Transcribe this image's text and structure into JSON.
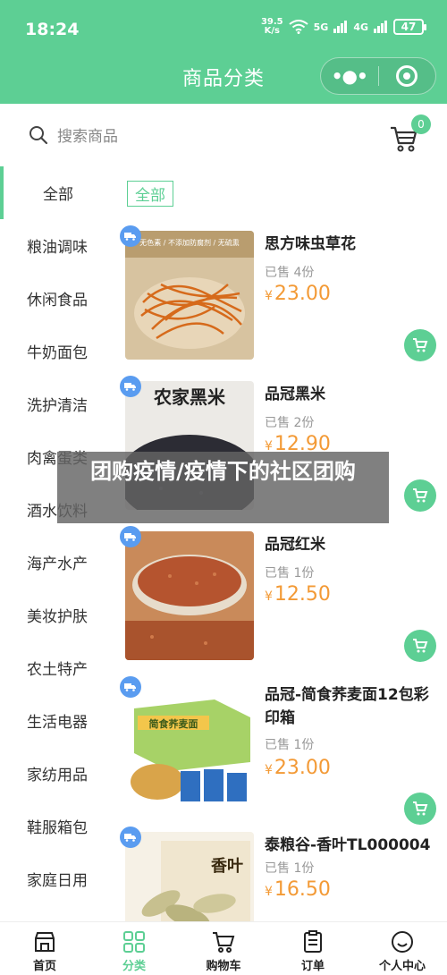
{
  "status": {
    "time": "18:24",
    "speed_top": "39.5",
    "speed_bottom": "K/s",
    "net": "5G",
    "net2": "4G",
    "battery": "47"
  },
  "header": {
    "title": "商品分类"
  },
  "search": {
    "placeholder": "搜索商品",
    "cart_count": "0"
  },
  "sidebar": {
    "items": [
      {
        "label": "全部"
      },
      {
        "label": "粮油调味"
      },
      {
        "label": "休闲食品"
      },
      {
        "label": "牛奶面包"
      },
      {
        "label": "洗护清洁"
      },
      {
        "label": "肉禽蛋类"
      },
      {
        "label": "酒水饮料"
      },
      {
        "label": "海产水产"
      },
      {
        "label": "美妆护肤"
      },
      {
        "label": "农土特产"
      },
      {
        "label": "生活电器"
      },
      {
        "label": "家纺用品"
      },
      {
        "label": "鞋服箱包"
      },
      {
        "label": "家庭日用"
      }
    ]
  },
  "content": {
    "filter_tag": "全部",
    "products": [
      {
        "name": "思方味虫草花",
        "sold": "已售 4份",
        "price_symbol": "¥",
        "price": "23.00",
        "img_text": "无色素 / 不添加防腐剂 / 无硫熏"
      },
      {
        "name": "品冠黑米",
        "sold": "已售 2份",
        "price_symbol": "¥",
        "price": "12.90",
        "img_text": "农家黑米"
      },
      {
        "name": "品冠红米",
        "sold": "已售 1份",
        "price_symbol": "¥",
        "price": "12.50",
        "img_text": ""
      },
      {
        "name": "品冠-简食荞麦面12包彩印箱",
        "sold": "已售 1份",
        "price_symbol": "¥",
        "price": "23.00",
        "img_text": "简食荞麦面"
      },
      {
        "name": "泰粮谷-香叶TL000004",
        "sold": "已售 1份",
        "price_symbol": "¥",
        "price": "16.50",
        "img_text": "香叶"
      }
    ]
  },
  "overlay": {
    "text": "团购疫情/疫情下的社区团购"
  },
  "tabbar": {
    "items": [
      {
        "label": "首页"
      },
      {
        "label": "分类"
      },
      {
        "label": "购物车"
      },
      {
        "label": "订单"
      },
      {
        "label": "个人中心"
      }
    ]
  },
  "colors": {
    "brand": "#5dcf94",
    "price": "#f39a36",
    "truck_badge": "#5a9cf0"
  }
}
